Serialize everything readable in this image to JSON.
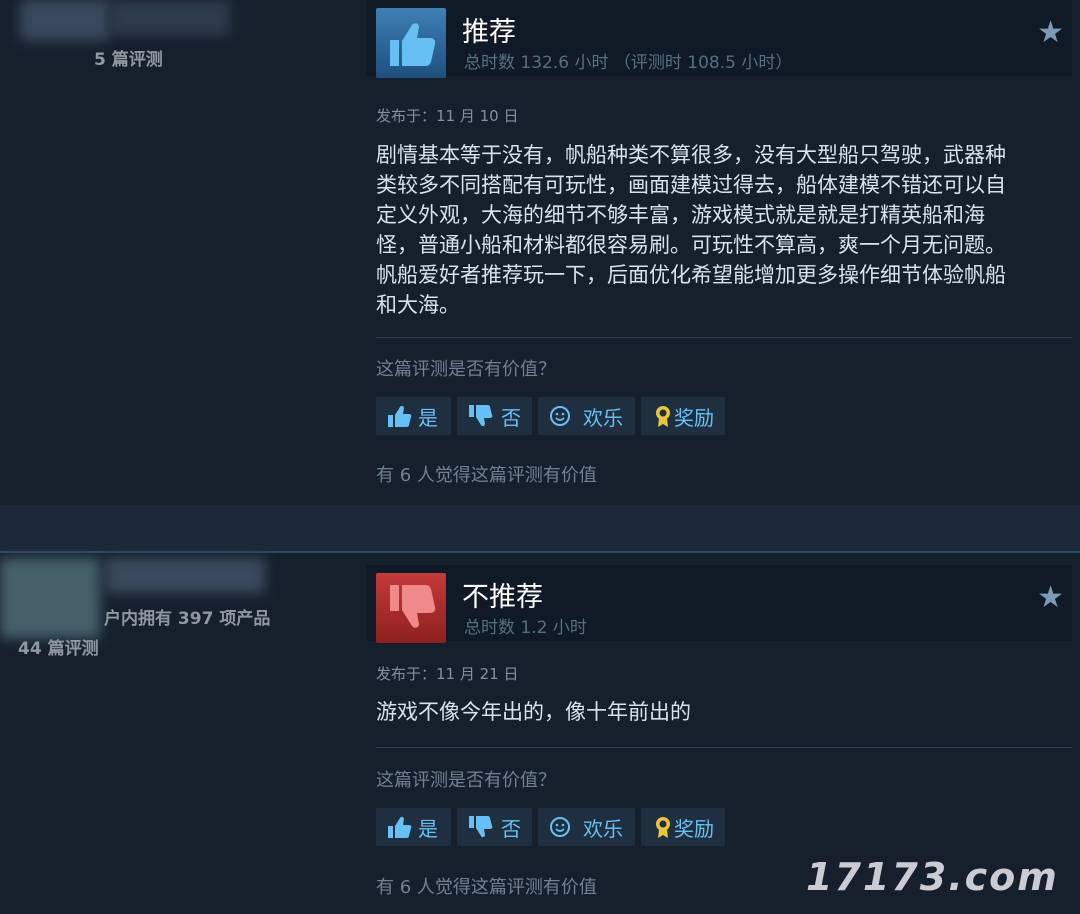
{
  "reviews": [
    {
      "author_stats": {
        "products_text": "",
        "reviews_text": "5 篇评测"
      },
      "verdict": "推荐",
      "hours": "总时数 132.6 小时 （评测时 108.5 小时）",
      "posted": "发布于：11 月 10 日",
      "body_lines": [
        "剧情基本等于没有，帆船种类不算很多，没有大型船只驾驶，武器种",
        "类较多不同搭配有可玩性，画面建模过得去，船体建模不错还可以自",
        "定义外观，大海的细节不够丰富，游戏模式就是就是打精英船和海",
        "怪，普通小船和材料都很容易刷。可玩性不算高，爽一个月无问题。",
        "帆船爱好者推荐玩一下，后面优化希望能增加更多操作细节体验帆船",
        "和大海。"
      ],
      "helpful_question": "这篇评测是否有价值？",
      "buttons": {
        "yes": "是",
        "no": "否",
        "funny": "欢乐",
        "award": "奖励"
      },
      "helpful_count": "有 6 人觉得这篇评测有价值"
    },
    {
      "author_stats": {
        "products_text": "户内拥有 397 项产品",
        "reviews_text": "44 篇评测"
      },
      "verdict": "不推荐",
      "hours": "总时数 1.2 小时",
      "posted": "发布于：11 月 21 日",
      "body_lines": [
        "游戏不像今年出的，像十年前出的"
      ],
      "helpful_question": "这篇评测是否有价值？",
      "buttons": {
        "yes": "是",
        "no": "否",
        "funny": "欢乐",
        "award": "奖励"
      },
      "helpful_count": "有 6 人觉得这篇评测有价值"
    }
  ],
  "watermark": "17173.com",
  "colors": {
    "accent": "#66c0f4",
    "recommend": "#3f7fb5",
    "not_recommend": "#c43a3a",
    "background": "#1b2838"
  }
}
